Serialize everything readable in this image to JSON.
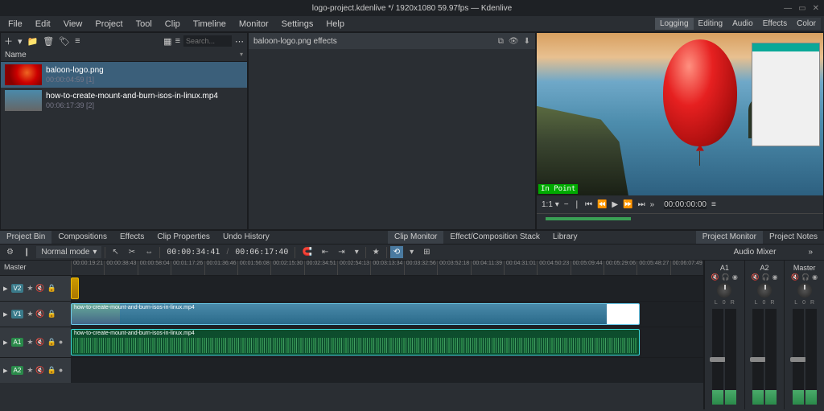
{
  "app": {
    "title": "logo-project.kdenlive */ 1920x1080 59.97fps — Kdenlive"
  },
  "menus": [
    "File",
    "Edit",
    "View",
    "Project",
    "Tool",
    "Clip",
    "Timeline",
    "Monitor",
    "Settings",
    "Help"
  ],
  "layout_tabs": [
    "Logging",
    "Editing",
    "Audio",
    "Effects",
    "Color"
  ],
  "layout_active": "Logging",
  "bin": {
    "header": "Name",
    "search_placeholder": "Search...",
    "items": [
      {
        "title": "baloon-logo.png",
        "meta": "00:00:04:59 [1]",
        "thumb": "balloon",
        "selected": true
      },
      {
        "title": "how-to-create-mount-and-burn-isos-in-linux.mp4",
        "meta": "00:06:17:39 [2]",
        "thumb": "video",
        "selected": false
      }
    ]
  },
  "effects_panel": {
    "title": "baloon-logo.png effects"
  },
  "monitor": {
    "in_point_label": "In Point",
    "zoom": "1:1",
    "timecode": "00:00:00:00"
  },
  "lower_tabs_left": [
    "Project Bin",
    "Compositions",
    "Effects",
    "Clip Properties",
    "Undo History"
  ],
  "lower_tabs_left_active": "Project Bin",
  "lower_tabs_mid": [
    "Clip Monitor",
    "Effect/Composition Stack",
    "Library"
  ],
  "lower_tabs_mid_active": "Clip Monitor",
  "lower_tabs_right": [
    "Project Monitor",
    "Project Notes"
  ],
  "lower_tabs_right_active": "Project Monitor",
  "timeline_toolbar": {
    "mode": "Normal mode",
    "tc1": "00:00:34:41",
    "tc2": "00:06:17:40"
  },
  "mixer_title": "Audio Mixer",
  "ruler_master": "Master",
  "ruler_ticks": [
    "00:00:19:21",
    "00:00:38:43",
    "00:00:58:04",
    "00:01:17:26",
    "00:01:36:46",
    "00:01:56:08",
    "00:02:15:30",
    "00:02:34:51",
    "00:02:54:13",
    "00:03:13:34",
    "00:03:32:56",
    "00:03:52:18",
    "00:04:11:39",
    "00:04:31:01",
    "00:04:50:23",
    "00:05:09:44",
    "00:05:29:06",
    "00:05:48:27",
    "00:06:07:49"
  ],
  "tracks": {
    "v2": {
      "tag": "V2",
      "clip_label": ""
    },
    "v1": {
      "tag": "V1",
      "clip_label": "how-to-create-mount-and-burn-isos-in-linux.mp4"
    },
    "a1": {
      "tag": "A1",
      "clip_label": "how-to-create-mount-and-burn-isos-in-linux.mp4"
    },
    "a2": {
      "tag": "A2"
    }
  },
  "track_icons": {
    "star": "★",
    "mute": "🔇",
    "lock": "🔒",
    "rec": "●"
  },
  "mixer_channels": [
    {
      "name": "A1"
    },
    {
      "name": "A2"
    },
    {
      "name": "Master"
    }
  ],
  "mixer_lr": {
    "l": "L",
    "o": "0",
    "r": "R"
  },
  "icons": {
    "plus": "＋",
    "folder": "📁",
    "trash": "🗑",
    "tag": "🏷",
    "list": "≡",
    "grid": "▦",
    "hamburger": "≡",
    "split": "⧉",
    "eye": "👁",
    "dl": "⬇",
    "gear": "⚙",
    "mark": "❙",
    "pointer": "↖",
    "razor": "✂",
    "spacer": "⇔",
    "snap": "🧲",
    "zone_in": "⇤",
    "zone_out": "⇥",
    "fav": "★",
    "reset": "⟲",
    "grid2": "⊞",
    "zoom_out": "−",
    "go_start": "⏮",
    "step_back": "⏪",
    "play": "▶",
    "step_fwd": "⏩",
    "go_end": "⏭",
    "more": "»",
    "hp": "🎧",
    "mute2": "🔇",
    "solo": "◉",
    "close": "✕",
    "chev": "▾",
    "dots": "⋯",
    "vbar": "❘"
  }
}
